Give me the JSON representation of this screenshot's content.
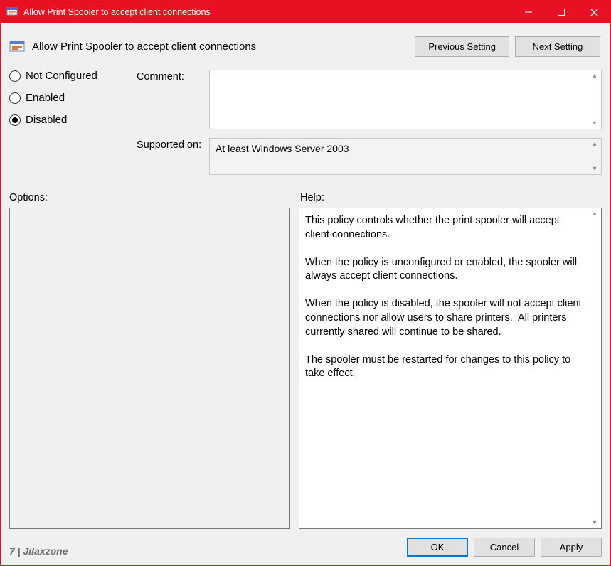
{
  "titlebar": {
    "title": "Allow Print Spooler to accept client connections"
  },
  "header": {
    "title": "Allow Print Spooler to accept client connections",
    "prev_label": "Previous Setting",
    "next_label": "Next Setting"
  },
  "radios": {
    "not_configured": "Not Configured",
    "enabled": "Enabled",
    "disabled": "Disabled",
    "selected": "disabled"
  },
  "fields": {
    "comment_label": "Comment:",
    "comment_value": "",
    "supported_label": "Supported on:",
    "supported_value": "At least Windows Server 2003"
  },
  "lower": {
    "options_label": "Options:",
    "help_label": "Help:",
    "help_text": "This policy controls whether the print spooler will accept client connections.\n\nWhen the policy is unconfigured or enabled, the spooler will always accept client connections.\n\nWhen the policy is disabled, the spooler will not accept client connections nor allow users to share printers.  All printers currently shared will continue to be shared.\n\nThe spooler must be restarted for changes to this policy to take effect."
  },
  "footer": {
    "watermark": "7 | Jilaxzone",
    "ok": "OK",
    "cancel": "Cancel",
    "apply": "Apply"
  }
}
